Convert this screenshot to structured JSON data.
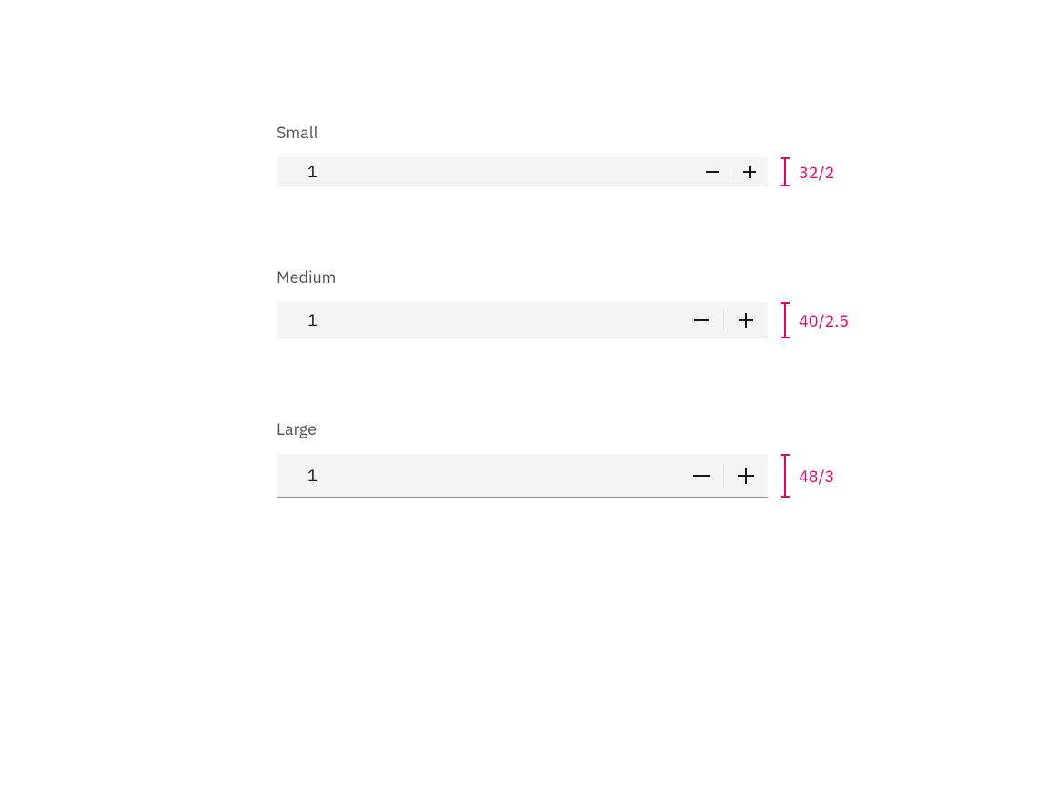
{
  "accent": "#e3066a",
  "steppers": [
    {
      "size": "sm",
      "label": "Small",
      "value": "1",
      "spec": "32/2"
    },
    {
      "size": "md",
      "label": "Medium",
      "value": "1",
      "spec": "40/2.5"
    },
    {
      "size": "lg",
      "label": "Large",
      "value": "1",
      "spec": "48/3"
    }
  ],
  "icons": {
    "minus": "minus-icon",
    "plus": "plus-icon"
  }
}
